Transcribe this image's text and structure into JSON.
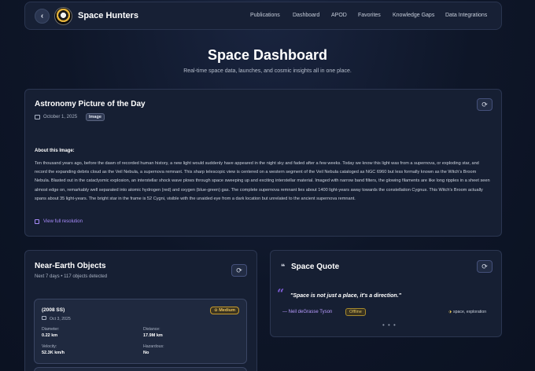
{
  "nav": {
    "brand": "Space Hunters",
    "links": [
      "Publications",
      "Dashboard",
      "APOD",
      "Favorites",
      "Knowledge Gaps",
      "Data Integrations"
    ]
  },
  "header": {
    "title": "Space Dashboard",
    "subtitle": "Real-time space data, launches, and cosmic insights all in one place."
  },
  "apod": {
    "title": "Astronomy Picture of the Day",
    "date": "October 1, 2025",
    "media_badge": "Image",
    "about_label": "About this Image:",
    "explanation": "Ten thousand years ago, before the dawn of recorded human history, a new light would suddenly have appeared in the night sky and faded after a few weeks. Today we know this light was from a supernova, or exploding star, and record the expanding debris cloud as the Veil Nebula, a supernova remnant. This sharp telescopic view is centered on a western segment of the Veil Nebula cataloged as NGC 6960 but less formally known as the Witch's Broom Nebula. Blasted out in the cataclysmic explosion, an interstellar shock wave plows through space sweeping up and exciting interstellar material. Imaged with narrow band filters, the glowing filaments are like long ripples in a sheet seen almost edge on, remarkably well separated into atomic hydrogen (red) and oxygen (blue-green) gas. The complete supernova remnant lies about 1400 light-years away towards the constellation Cygnus. This Witch's Broom actually spans about 35 light-years. The bright star in the frame is 52 Cygni, visible with the unaided eye from a dark location but unrelated to the ancient supernova remnant.",
    "full_res_label": "View full resolution"
  },
  "neo": {
    "title": "Near-Earth Objects",
    "subtitle": "Next 7 days • 117 objects detected",
    "items": [
      {
        "name": "(2008 SS)",
        "date": "Oct 3, 2025",
        "risk": "Medium",
        "diameter_label": "Diameter:",
        "diameter": "0.22 km",
        "distance_label": "Distance:",
        "distance": "17.9M km",
        "velocity_label": "Velocity:",
        "velocity": "52.3K km/h",
        "hazardous_label": "Hazardous:",
        "hazardous": "No"
      }
    ]
  },
  "quote": {
    "title": "Space Quote",
    "text": "\"Space is not just a place, it's a direction.\"",
    "author": "— Neil deGrasse Tyson",
    "status": "Offline",
    "tags": "space, exploration",
    "more": "• • •"
  },
  "colors": {
    "accent": "#a78bfa",
    "warning": "#e8c15a",
    "background": "#0e1628",
    "card": "#161f33"
  }
}
